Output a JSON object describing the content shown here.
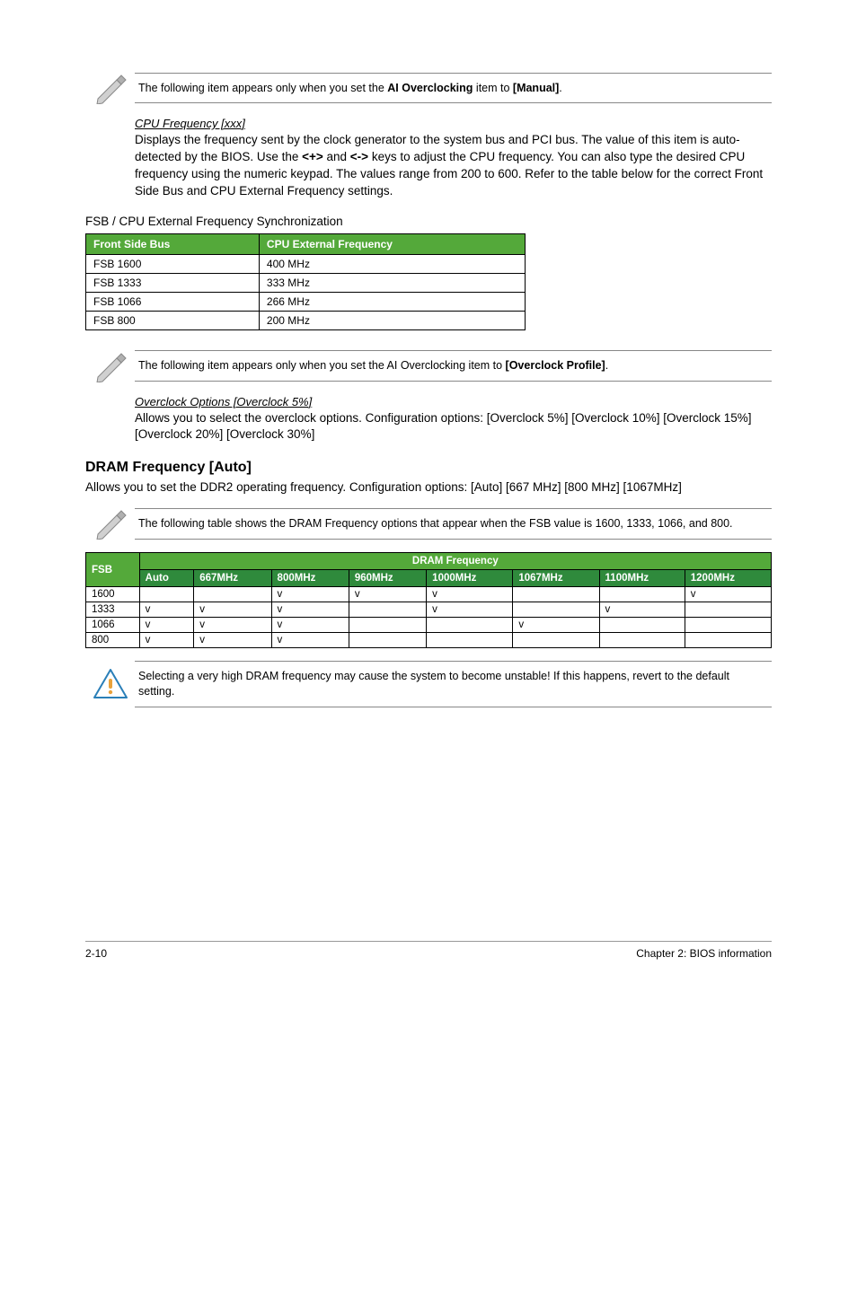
{
  "note1": {
    "pre": "The following item appears only when you set the ",
    "bold1": "AI Overclocking",
    "mid": " item to ",
    "bold2": "[Manual]",
    "post": "."
  },
  "cpuFreq": {
    "title": "CPU Frequency [xxx]",
    "desc_pre": "Displays the frequency sent by the clock generator to the system bus and PCI bus. The value of this item is auto-detected by the BIOS. Use the ",
    "key1": "<+>",
    "mid": " and ",
    "key2": "<->",
    "desc_post": " keys to adjust the CPU frequency. You can also type the desired CPU frequency using the numeric keypad. The values range from 200 to 600. Refer to the table below for the correct Front Side Bus and CPU External Frequency settings."
  },
  "fsbHeading": "FSB / CPU External Frequency Synchronization",
  "fsbTable": {
    "header": {
      "c0": "Front Side Bus",
      "c1": "CPU External Frequency"
    },
    "rows": [
      {
        "c0": "FSB 1600",
        "c1": "400 MHz"
      },
      {
        "c0": "FSB 1333",
        "c1": "333 MHz"
      },
      {
        "c0": "FSB 1066",
        "c1": "266 MHz"
      },
      {
        "c0": "FSB 800",
        "c1": "200 MHz"
      }
    ]
  },
  "note2": {
    "pre": "The following item appears only when you set the AI Overclocking item to ",
    "bold": "[Overclock Profile]",
    "post": "."
  },
  "overclock": {
    "title": "Overclock Options [Overclock 5%]",
    "desc": "Allows you to select the overclock options. Configuration options: [Overclock 5%] [Overclock 10%] [Overclock 15%] [Overclock 20%] [Overclock 30%]"
  },
  "dramHeading": "DRAM Frequency [Auto]",
  "dramDesc": "Allows you to set the DDR2 operating frequency. Configuration options: [Auto] [667 MHz] [800 MHz] [1067MHz]",
  "note3": "The following table shows the DRAM Frequency options that appear when the FSB value is 1600, 1333, 1066, and 800.",
  "dramTable": {
    "colFSB": "FSB",
    "groupHeader": "DRAM Frequency",
    "cols": {
      "c0": "Auto",
      "c1": "667MHz",
      "c2": "800MHz",
      "c3": "960MHz",
      "c4": "1000MHz",
      "c5": "1067MHz",
      "c6": "1100MHz",
      "c7": "1200MHz"
    },
    "rows": [
      {
        "fsb": "1600",
        "c0": "",
        "c1": "",
        "c2": "v",
        "c3": "v",
        "c4": "v",
        "c5": "",
        "c6": "",
        "c7": "v"
      },
      {
        "fsb": "1333",
        "c0": "v",
        "c1": "v",
        "c2": "v",
        "c3": "",
        "c4": "v",
        "c5": "",
        "c6": "v",
        "c7": ""
      },
      {
        "fsb": "1066",
        "c0": "v",
        "c1": "v",
        "c2": "v",
        "c3": "",
        "c4": "",
        "c5": "v",
        "c6": "",
        "c7": ""
      },
      {
        "fsb": "800",
        "c0": "v",
        "c1": "v",
        "c2": "v",
        "c3": "",
        "c4": "",
        "c5": "",
        "c6": "",
        "c7": ""
      }
    ]
  },
  "caution": "Selecting a very high DRAM frequency may cause the system to become unstable! If this happens, revert to the default setting.",
  "footer": {
    "left": "2-10",
    "right": "Chapter 2: BIOS information"
  },
  "chart_data": [
    {
      "type": "table",
      "title": "FSB / CPU External Frequency Synchronization",
      "columns": [
        "Front Side Bus",
        "CPU External Frequency"
      ],
      "rows": [
        [
          "FSB 1600",
          "400 MHz"
        ],
        [
          "FSB 1333",
          "333 MHz"
        ],
        [
          "FSB 1066",
          "266 MHz"
        ],
        [
          "FSB 800",
          "200 MHz"
        ]
      ]
    },
    {
      "type": "table",
      "title": "DRAM Frequency options by FSB",
      "columns": [
        "FSB",
        "Auto",
        "667MHz",
        "800MHz",
        "960MHz",
        "1000MHz",
        "1067MHz",
        "1100MHz",
        "1200MHz"
      ],
      "rows": [
        [
          "1600",
          "",
          "",
          "v",
          "v",
          "v",
          "",
          "",
          "v"
        ],
        [
          "1333",
          "v",
          "v",
          "v",
          "",
          "v",
          "",
          "v",
          ""
        ],
        [
          "1066",
          "v",
          "v",
          "v",
          "",
          "",
          "v",
          "",
          ""
        ],
        [
          "800",
          "v",
          "v",
          "v",
          "",
          "",
          "",
          "",
          ""
        ]
      ]
    }
  ]
}
